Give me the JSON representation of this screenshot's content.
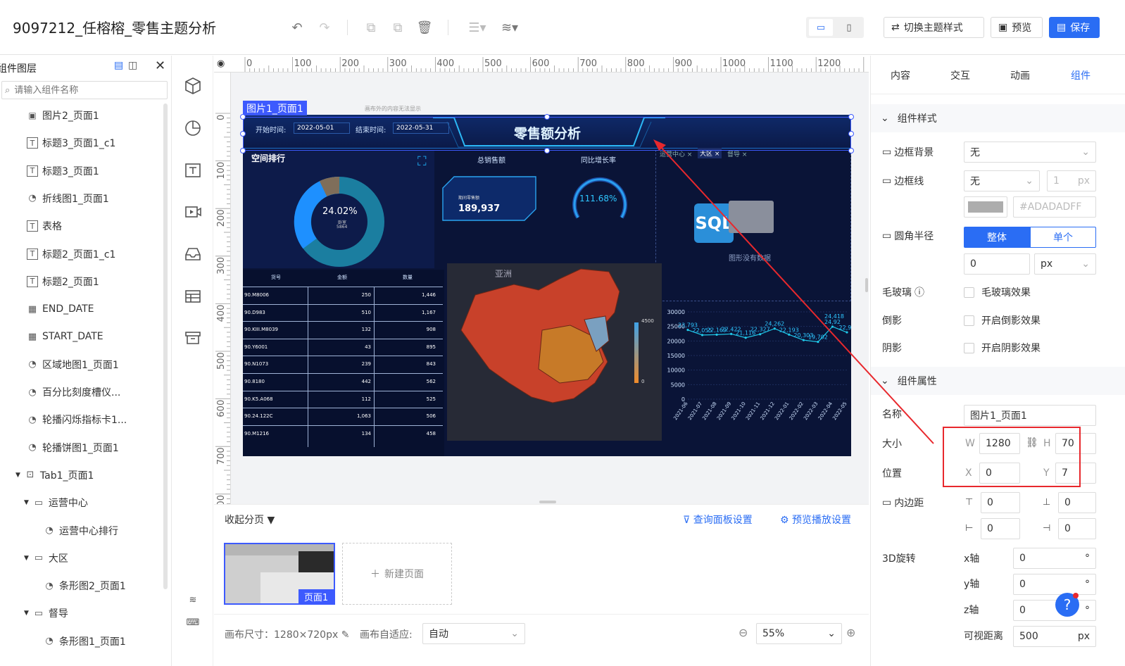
{
  "header": {
    "title": "9097212_任榕榕_零售主题分析",
    "switch_theme": "切换主题样式",
    "preview": "预览",
    "save": "保存"
  },
  "layers": {
    "title": "组件图层",
    "search_placeholder": "请输入组件名称",
    "items": [
      {
        "label": "图片2_页面1",
        "icon": "image-icon"
      },
      {
        "label": "标题3_页面1_c1",
        "icon": "text-icon"
      },
      {
        "label": "标题3_页面1",
        "icon": "text-icon"
      },
      {
        "label": "折线图1_页面1",
        "icon": "chart-icon"
      },
      {
        "label": "表格",
        "icon": "text-icon"
      },
      {
        "label": "标题2_页面1_c1",
        "icon": "text-icon"
      },
      {
        "label": "标题2_页面1",
        "icon": "text-icon"
      },
      {
        "label": "END_DATE",
        "icon": "table-icon"
      },
      {
        "label": "START_DATE",
        "icon": "table-icon"
      },
      {
        "label": "区域地图1_页面1",
        "icon": "chart-icon"
      },
      {
        "label": "百分比刻度槽仪...",
        "icon": "chart-icon"
      },
      {
        "label": "轮播闪烁指标卡1...",
        "icon": "chart-icon"
      },
      {
        "label": "轮播饼图1_页面1",
        "icon": "chart-icon"
      },
      {
        "label": "Tab1_页面1",
        "icon": "inbox-icon"
      },
      {
        "label": "运营中心",
        "icon": "folder-icon"
      },
      {
        "label": "运营中心排行",
        "icon": "chart-icon"
      },
      {
        "label": "大区",
        "icon": "folder-icon"
      },
      {
        "label": "条形图2_页面1",
        "icon": "chart-icon"
      },
      {
        "label": "督导",
        "icon": "folder-icon"
      },
      {
        "label": "条形图1_页面1",
        "icon": "chart-icon"
      }
    ]
  },
  "ruler": {
    "top": [
      "0",
      "100",
      "200",
      "300",
      "400",
      "500",
      "600",
      "700",
      "800",
      "900",
      "1000",
      "1100",
      "1200"
    ],
    "left": [
      "0",
      "100",
      "200",
      "300",
      "400",
      "500",
      "600",
      "700",
      "800"
    ]
  },
  "canvas": {
    "selected_label": "图片1_页面1",
    "hint": "画布外的内容无法显示"
  },
  "dashboard": {
    "title": "零售额分析",
    "start_label": "开始时间:",
    "start_value": "2022-05-01",
    "end_label": "结束时间:",
    "end_value": "2022-05-31",
    "space_rank": "空间排行",
    "donut_pct": "24.02%",
    "donut_sub1": "卧室",
    "donut_sub2": "5864",
    "total_sales": "总销售额",
    "yoy": "同比增长率",
    "card_label": "期间零售额",
    "card_value": "189,937",
    "gauge_value": "111.68%",
    "tabs": [
      "运营中心",
      "大区",
      "督导"
    ],
    "no_data": "图形没有数据",
    "map_title": "亚洲",
    "legend_max": "4500",
    "legend_min": "0",
    "table": {
      "headers": [
        "货号",
        "金额",
        "数量"
      ],
      "rows": [
        [
          "90.M8006",
          "250",
          "1,446"
        ],
        [
          "90.D983",
          "510",
          "1,167"
        ],
        [
          "90.KIII.M8039",
          "132",
          "908"
        ],
        [
          "90.Y6001",
          "43",
          "895"
        ],
        [
          "90.N1073",
          "239",
          "843"
        ],
        [
          "90.8180",
          "442",
          "562"
        ],
        [
          "90.K5.A068",
          "112",
          "525"
        ],
        [
          "90.24.122C",
          "1,063",
          "506"
        ],
        [
          "90.M1216",
          "134",
          "458"
        ]
      ]
    }
  },
  "chart_data": {
    "type": "line",
    "categories": [
      "2021-06",
      "2021-07",
      "2021-08",
      "2021-09",
      "2021-10",
      "2021-11",
      "2021-12",
      "2022-01",
      "2022-02",
      "2022-03",
      "2022-04",
      "2022-05"
    ],
    "values": [
      23793,
      22055,
      22169,
      22422,
      21116,
      22327,
      24262,
      22193,
      20303,
      19702,
      24922,
      22970
    ],
    "data_labels": [
      "23,793",
      "22,055",
      "22,169",
      "22,422",
      "21,116",
      "22,327",
      "24,262",
      "22,193",
      "20,303",
      "19,702",
      "24,92",
      "22,97"
    ],
    "last_label": "24,418",
    "yticks": [
      "0",
      "5000",
      "10000",
      "15000",
      "20000",
      "25000",
      "30000"
    ],
    "ylim": [
      0,
      30000
    ]
  },
  "pages": {
    "collapse": "收起分页",
    "query_panel": "查询面板设置",
    "preview_play": "预览播放设置",
    "page_name": "页面1",
    "new_page": "新建页面"
  },
  "bottombar": {
    "canvas_size": "画布尺寸：1280×720px",
    "adapt_label": "画布自适应:",
    "adapt_value": "自动",
    "zoom": "55%"
  },
  "props": {
    "tabs": [
      "内容",
      "交互",
      "动画",
      "组件"
    ],
    "style_section": "组件样式",
    "border_bg": "边框背景",
    "border_bg_value": "无",
    "border_line": "边框线",
    "border_line_value": "无",
    "border_width": "1",
    "px": "px",
    "color_hex": "#ADADADFF",
    "radius": "圆角半径",
    "radius_whole": "整体",
    "radius_single": "单个",
    "radius_value": "0",
    "glass": "毛玻璃",
    "glass_opt": "毛玻璃效果",
    "reflect": "倒影",
    "reflect_opt": "开启倒影效果",
    "shadow": "阴影",
    "shadow_opt": "开启阴影效果",
    "attr_section": "组件属性",
    "name_label": "名称",
    "name_value": "图片1_页面1",
    "size_label": "大小",
    "w_label": "W",
    "w_value": "1280",
    "h_label": "H",
    "h_value": "70",
    "pos_label": "位置",
    "x_label": "X",
    "x_value": "0",
    "y_label": "Y",
    "y_value": "7",
    "padding_label": "内边距",
    "pad_top": "0",
    "pad_bottom": "0",
    "pad_left": "0",
    "pad_right": "0",
    "rot_label": "3D旋转",
    "x_axis": "x轴",
    "y_axis": "y轴",
    "z_axis": "z轴",
    "rot_x": "0",
    "rot_y": "0",
    "rot_z": "0",
    "degree": "°",
    "view_dist": "可视距离",
    "view_dist_value": "500",
    "help": "?"
  },
  "colors": {
    "accent": "#2a6df4",
    "selection": "#3d5afe",
    "annotation": "#e8282d",
    "dash_bg": "#0a1437",
    "map_red": "#c8412a",
    "line_cyan": "#1fc8e8"
  }
}
